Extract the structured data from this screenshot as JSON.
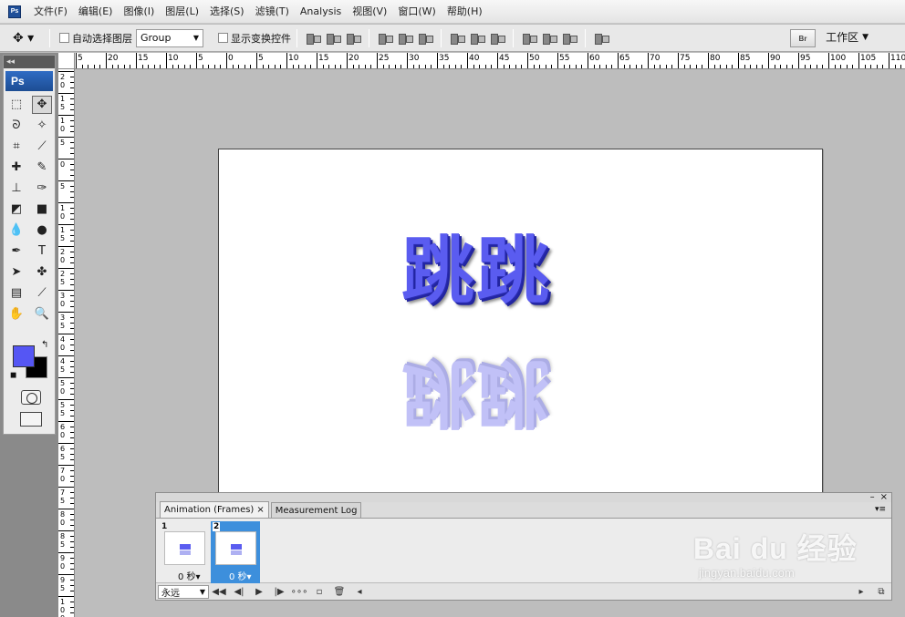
{
  "menubar": {
    "app_icon_text": "Ps",
    "items": [
      "文件(F)",
      "编辑(E)",
      "图像(I)",
      "图层(L)",
      "选择(S)",
      "滤镜(T)",
      "Analysis",
      "视图(V)",
      "窗口(W)",
      "帮助(H)"
    ]
  },
  "options": {
    "auto_select_label": "自动选择图层",
    "auto_select_value": "Group",
    "show_transform_label": "显示变换控件",
    "bridge_label": "Br",
    "workspace_label": "工作区"
  },
  "toolbox": {
    "badge": "Ps",
    "collapse_glyph": "◂◂",
    "foreground_color": "#5556f4",
    "background_color": "#000000"
  },
  "rulers": {
    "h_labels": [
      "5",
      "20",
      "15",
      "10",
      "5",
      "0",
      "5",
      "10",
      "15",
      "20",
      "25",
      "30",
      "35",
      "40",
      "45",
      "50",
      "55",
      "60",
      "65",
      "70",
      "75",
      "80",
      "85",
      "90",
      "95",
      "100",
      "105",
      "110"
    ],
    "v_labels": [
      "2 0",
      "1 5",
      "1 0",
      "5",
      "0",
      "5",
      "1 0",
      "1 5",
      "2 0",
      "2 5",
      "3 0",
      "3 5",
      "4 0",
      "4 5",
      "5 0",
      "5 5",
      "6 0",
      "6 5",
      "7 0",
      "7 5",
      "8 0",
      "8 5",
      "9 0",
      "9 5",
      "1 0 0"
    ]
  },
  "canvas": {
    "glyphs": [
      "跳",
      "跳"
    ],
    "glyph_color": "#5a5cf0"
  },
  "animation_panel": {
    "tabs": [
      {
        "label": "Animation (Frames)",
        "close": "×"
      },
      {
        "label": "Measurement Log",
        "close": ""
      }
    ],
    "window_controls": [
      "–",
      "×"
    ],
    "panel_menu": "▾≡",
    "frames": [
      {
        "number": "1",
        "delay": "0 秒▾"
      },
      {
        "number": "2",
        "delay": "0 秒▾"
      }
    ],
    "loop_value": "永远",
    "controls": [
      "◀◀",
      "◀|",
      "▶",
      "|▶",
      "∘∘∘",
      "▫",
      "🗑",
      "◂",
      "▸"
    ]
  },
  "watermark": {
    "logo": "Bai du 经验",
    "url": "jingyan.baidu.com"
  }
}
